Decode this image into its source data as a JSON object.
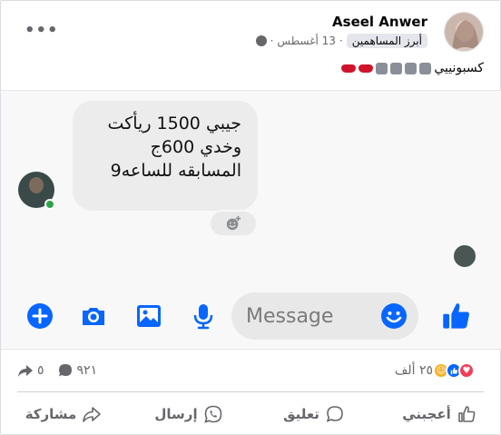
{
  "post": {
    "author": "Aseel Anwer",
    "badge": "أبرز المساهمين",
    "date": "13 أغسطس",
    "separator": "·",
    "caption_text": "كسبونييي",
    "more_label": "•••"
  },
  "chat": {
    "message_lines": [
      "جيبي 1500 ريأكت",
      "وخدي 600ج",
      "المسابقه للساعه9"
    ],
    "input_placeholder": "Message"
  },
  "stats": {
    "reactions_count": "٢٥ ألف",
    "comments_count": "٩٢١",
    "shares_count": "٥"
  },
  "actions": {
    "like": "أعجبني",
    "comment": "تعليق",
    "send": "إرسال",
    "share": "مشاركة"
  },
  "colors": {
    "accent": "#0866ff",
    "online": "#31a24c",
    "love": "#f33e58",
    "care": "#f7b125"
  },
  "icons": [
    "more-icon",
    "globe-icon",
    "lips-emoji",
    "face-emoji",
    "add-reaction-icon",
    "plus-icon",
    "camera-icon",
    "image-icon",
    "mic-icon",
    "smile-icon",
    "thumbs-up-icon",
    "share-arrow-icon",
    "comment-bubble-icon"
  ]
}
